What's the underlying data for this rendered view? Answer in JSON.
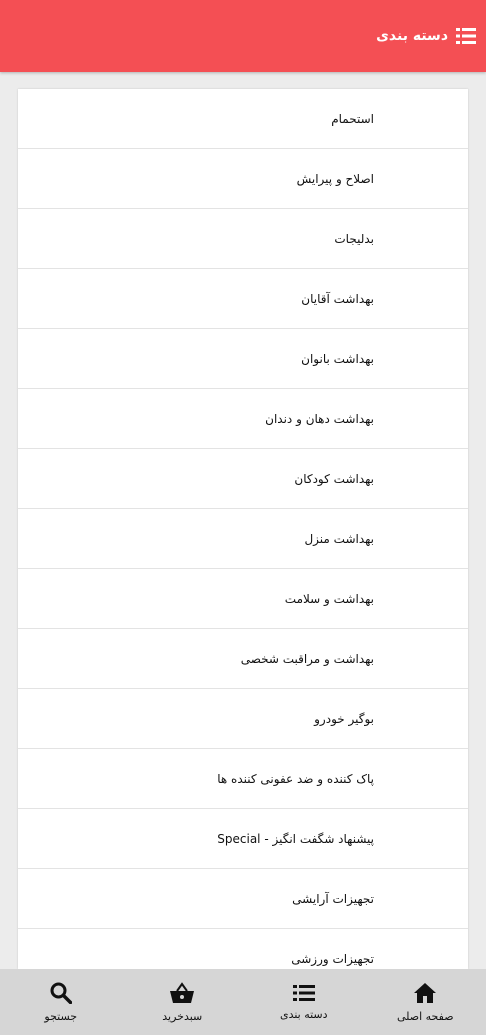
{
  "colors": {
    "accent": "#f44f54",
    "nav_bg": "#d6d6d6",
    "page_bg": "#ececec"
  },
  "header": {
    "title": "دسته بندی",
    "icon": "list-icon"
  },
  "categories": [
    "استحمام",
    "اصلاح و پیرایش",
    "بدلیجات",
    "بهداشت آقایان",
    "بهداشت بانوان",
    "بهداشت دهان و دندان",
    "بهداشت کودکان",
    "بهداشت منزل",
    "بهداشت و سلامت",
    "بهداشت و مراقبت شخصی",
    "بوگیر خودرو",
    "پاک کننده و ضد عفونی کننده ها",
    "پیشنهاد شگفت انگیز - Special",
    "تجهیزات آرایشی",
    "تجهیزات ورزشی"
  ],
  "bottom_nav": [
    {
      "label": "صفحه اصلی",
      "icon": "home-icon"
    },
    {
      "label": "دسته بندی",
      "icon": "list-icon"
    },
    {
      "label": "سبدخرید",
      "icon": "basket-icon"
    },
    {
      "label": "جستجو",
      "icon": "search-icon"
    }
  ]
}
